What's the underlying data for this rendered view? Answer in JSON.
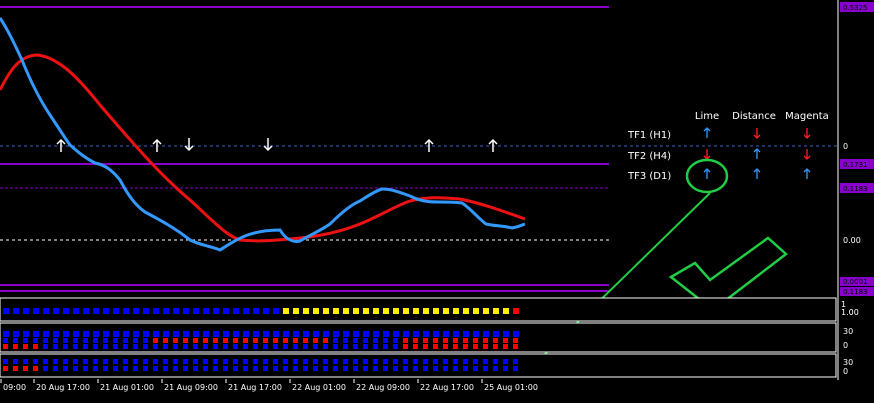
{
  "price_labels": {
    "top": "0.5325",
    "zero": "0",
    "p1": "0.1731",
    "p2": "0.1183",
    "p3": "0.00",
    "bottom_a": "0.0001",
    "bottom_b": "0.1183"
  },
  "sub_axes": {
    "ind1_top": "1",
    "ind1_mid": "1.00",
    "ind2_top": "30",
    "ind2_bottom": "0",
    "ind3_top": "30",
    "ind3_bottom": "0"
  },
  "table": {
    "headers": [
      "Lime",
      "Distance",
      "Magenta"
    ],
    "rows": [
      {
        "label": "TF1 (H1)",
        "cells": [
          "up",
          "down",
          "down"
        ]
      },
      {
        "label": "TF2 (H4)",
        "cells": [
          "down",
          "up",
          "down"
        ]
      },
      {
        "label": "TF3 (D1)",
        "cells": [
          "up",
          "up",
          "up"
        ]
      }
    ]
  },
  "time_axis": [
    "09:00",
    "20 Aug 17:00",
    "21 Aug 01:00",
    "21 Aug 09:00",
    "21 Aug 17:00",
    "22 Aug 01:00",
    "22 Aug 09:00",
    "22 Aug 17:00",
    "25 Aug 01:00"
  ],
  "signal_arrows": [
    "up",
    "up",
    "down",
    "down",
    "up",
    "up"
  ],
  "colors": {
    "blue_line": "#3399ff",
    "red_line": "#ee1111",
    "magenta": "#8800cc",
    "up_arrow_table": "#3399ff",
    "down_arrow_table": "#ff2222",
    "annotation": "#22cc44",
    "dot_blue": "#0000ff",
    "dot_red": "#ff0000",
    "dot_yellow": "#ffee00"
  },
  "indicator_rows": {
    "ind1": [
      {
        "color": "blue",
        "count": 28
      },
      {
        "color": "yellow",
        "count": 23
      },
      {
        "color": "red",
        "count": 1
      }
    ],
    "ind2_row1": [
      {
        "color": "blue",
        "count": 52
      }
    ],
    "ind2_row2": [
      {
        "color": "blue",
        "count": 15
      },
      {
        "color": "red",
        "count": 18
      },
      {
        "color": "blue",
        "count": 7
      },
      {
        "color": "red",
        "count": 12
      }
    ],
    "ind2_row3": [
      {
        "color": "red",
        "count": 4
      },
      {
        "color": "blue",
        "count": 36
      },
      {
        "color": "red",
        "count": 12
      }
    ],
    "ind3_row1": [
      {
        "color": "blue",
        "count": 52
      }
    ],
    "ind3_row2": [
      {
        "color": "red",
        "count": 4
      },
      {
        "color": "blue",
        "count": 48
      }
    ]
  }
}
